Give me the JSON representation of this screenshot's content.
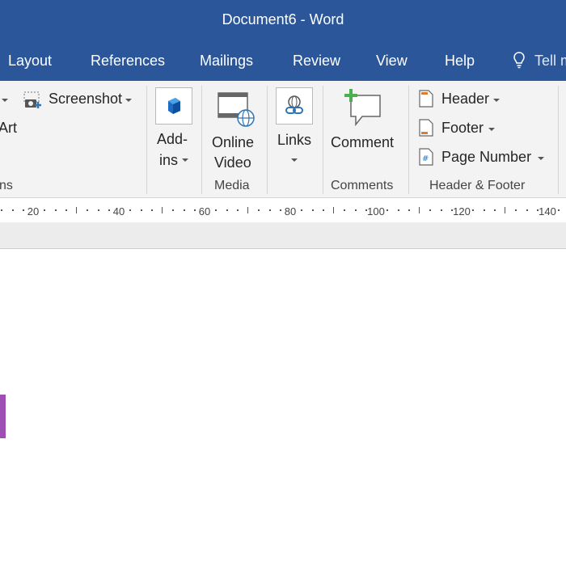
{
  "window": {
    "title": "Document6  -  Word"
  },
  "tabs": [
    {
      "label": "Layout"
    },
    {
      "label": "References"
    },
    {
      "label": "Mailings"
    },
    {
      "label": "Review"
    },
    {
      "label": "View"
    },
    {
      "label": "Help"
    }
  ],
  "tell_me": {
    "label": "Tell m"
  },
  "ribbon": {
    "illustrations": {
      "screenshot_label": "Screenshot",
      "smartart_fragment": "Art",
      "group_fragment": "ns"
    },
    "addins": {
      "label_line1": "Add-",
      "label_line2": "ins"
    },
    "media": {
      "label_line1": "Online",
      "label_line2": "Video",
      "group": "Media"
    },
    "links": {
      "label": "Links"
    },
    "comments": {
      "label": "Comment",
      "group": "Comments"
    },
    "header_footer": {
      "header": "Header",
      "footer": "Footer",
      "page_number": "Page Number",
      "group": "Header & Footer"
    }
  },
  "ruler": {
    "labels": [
      "20",
      "40",
      "60",
      "80",
      "100",
      "120",
      "140"
    ]
  },
  "colors": {
    "title_bar": "#2b579a",
    "ribbon": "#f3f3f3",
    "accent_mark": "#9e4fb3"
  }
}
